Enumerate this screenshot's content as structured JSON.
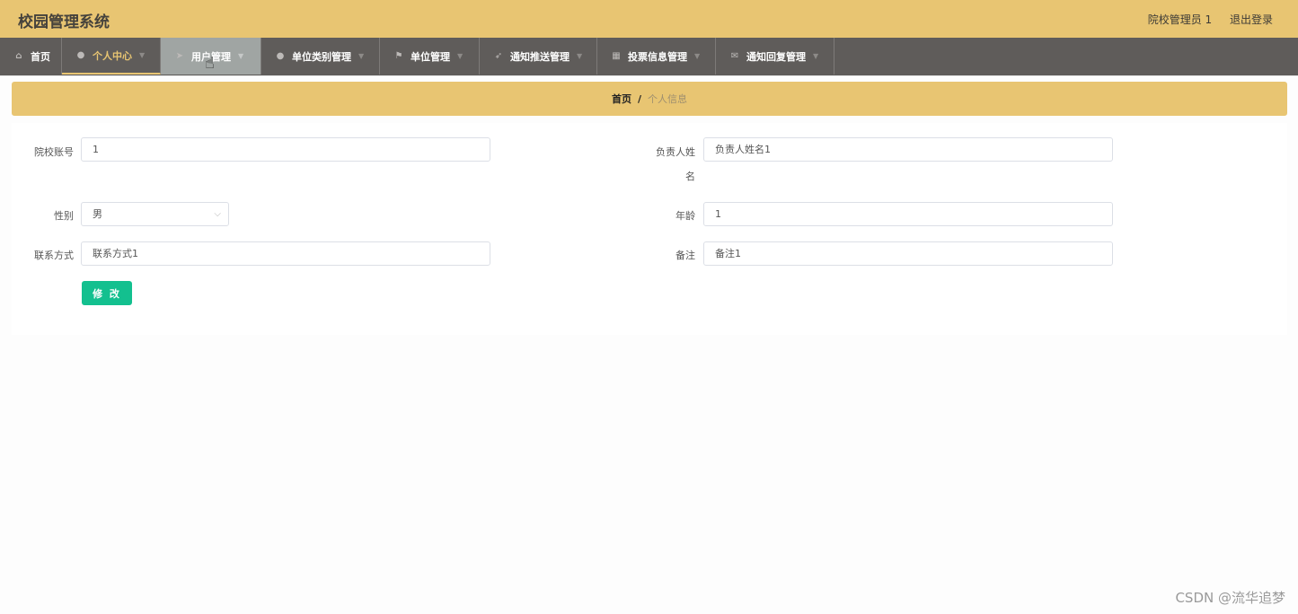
{
  "header": {
    "title": "校园管理系统",
    "user": "院校管理员 1",
    "logout": "退出登录"
  },
  "nav": [
    {
      "label": "首页",
      "icon": "home-icon"
    },
    {
      "label": "个人中心",
      "icon": "user-icon"
    },
    {
      "label": "用户管理",
      "icon": "send-icon"
    },
    {
      "label": "单位类别管理",
      "icon": "location-icon"
    },
    {
      "label": "单位管理",
      "icon": "flag-icon"
    },
    {
      "label": "通知推送管理",
      "icon": "navigation-icon"
    },
    {
      "label": "投票信息管理",
      "icon": "grid-icon"
    },
    {
      "label": "通知回复管理",
      "icon": "mail-icon"
    }
  ],
  "breadcrumb": {
    "home": "首页",
    "separator": "/",
    "current": "个人信息"
  },
  "form": {
    "account_label": "院校账号",
    "account_value": "1",
    "name_label_1": "负责人姓",
    "name_label_2": "名",
    "name_value": "负责人姓名1",
    "gender_label": "性别",
    "gender_value": "男",
    "age_label": "年龄",
    "age_value": "1",
    "contact_label": "联系方式",
    "contact_value": "联系方式1",
    "remark_label": "备注",
    "remark_value": "备注1",
    "submit": "修 改"
  },
  "watermark": "CSDN @流华追梦",
  "colors": {
    "header": "#e8c572",
    "nav": "#5f5c5a",
    "button": "#13c08f"
  }
}
